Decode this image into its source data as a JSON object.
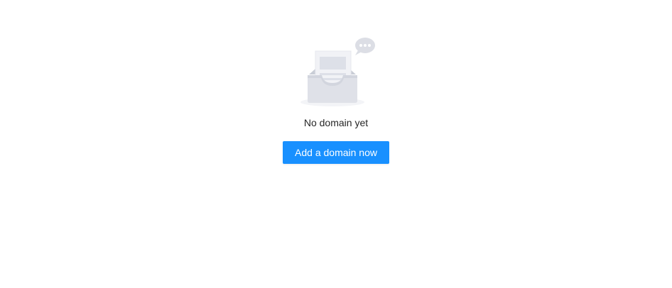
{
  "empty_state": {
    "illustration_icon": "empty-inbox-icon",
    "message": "No domain yet",
    "action_label": "Add a domain now"
  },
  "colors": {
    "primary": "#1890ff",
    "text": "#262626",
    "illustration_light": "#f0f1f5",
    "illustration_mid": "#dde0e8",
    "illustration_dark": "#c6cad4"
  }
}
